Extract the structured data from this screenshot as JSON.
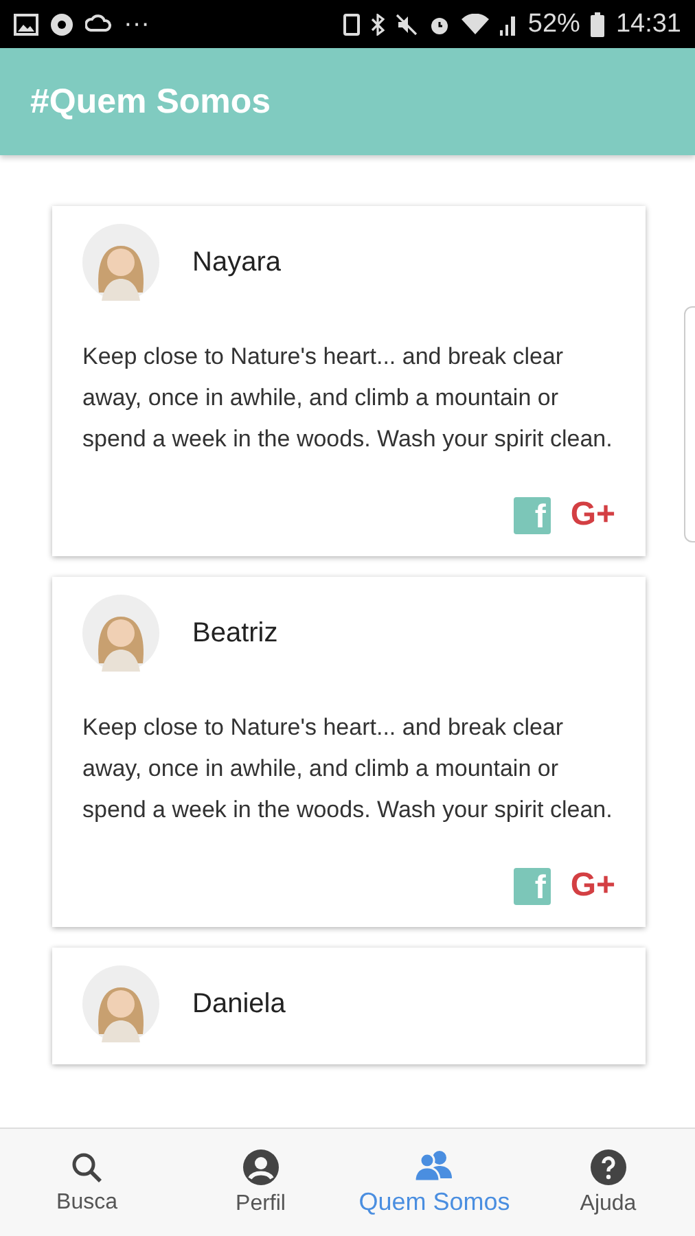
{
  "status_bar": {
    "battery": "52%",
    "time": "14:31",
    "more": "···"
  },
  "app_bar": {
    "title": "#Quem Somos"
  },
  "members": [
    {
      "name": "Nayara",
      "quote": "Keep close to Nature's heart... and break clear away, once in awhile, and climb a mountain or spend a week in the woods. Wash your spirit clean.",
      "social": [
        {
          "kind": "facebook",
          "glyph": "f"
        },
        {
          "kind": "google",
          "glyph": "G+"
        }
      ]
    },
    {
      "name": "Beatriz",
      "quote": "Keep close to Nature's heart... and break clear away, once in awhile, and climb a mountain or spend a week in the woods. Wash your spirit clean.",
      "social": [
        {
          "kind": "facebook",
          "glyph": "f"
        },
        {
          "kind": "google",
          "glyph": "G+"
        }
      ]
    },
    {
      "name": "Daniela"
    }
  ],
  "nav": [
    {
      "kind": "search",
      "label": "Busca",
      "selected": false
    },
    {
      "kind": "profile",
      "label": "Perfil",
      "selected": false
    },
    {
      "kind": "team",
      "label": "Quem Somos",
      "selected": true
    },
    {
      "kind": "help",
      "label": "Ajuda",
      "selected": false
    }
  ]
}
